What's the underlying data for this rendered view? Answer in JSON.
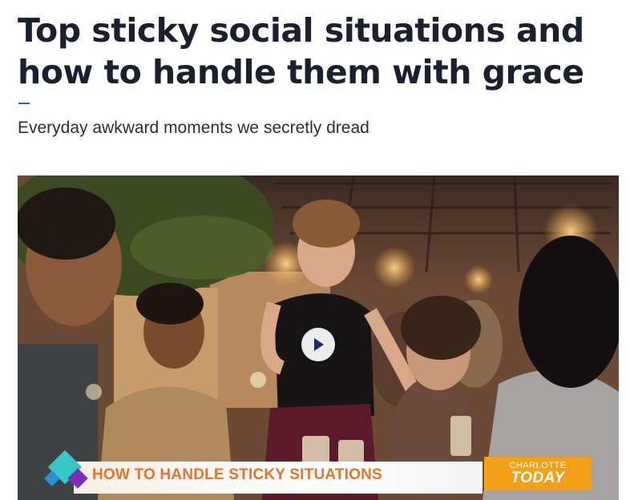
{
  "article": {
    "headline": "Top sticky social situations and how to handle them with grace",
    "dek": "Everyday awkward moments we secretly dread"
  },
  "video": {
    "lower_third_text": "HOW TO HANDLE STICKY SITUATIONS",
    "brand_top": "CHARLOTTE",
    "brand_bottom": "TODAY",
    "play_icon": "play-icon"
  },
  "colors": {
    "accent_rule": "#2563c9",
    "lower_third_text": "#e8742a",
    "brand_badge": "#f4a018"
  }
}
